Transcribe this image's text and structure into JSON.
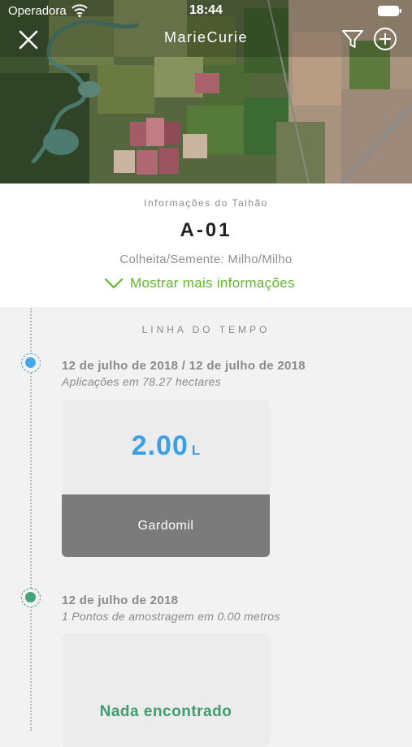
{
  "status_bar": {
    "carrier": "Operadora",
    "time": "18:44"
  },
  "nav": {
    "title": "MarieCurie"
  },
  "icons": {
    "close": "close-icon",
    "filter": "filter-icon",
    "add": "add-circle-icon",
    "wifi": "wifi-icon",
    "battery": "battery-icon",
    "more": "chevron-down-icon"
  },
  "colors": {
    "accent_green": "#5fb82f",
    "application_blue": "#3a9fe6",
    "sample_green": "#3f9e70"
  },
  "plot": {
    "section_label": "Informações do Talhão",
    "name": "A-01",
    "harvest": "Colheita/Semente: Milho/Milho",
    "more_info": "Mostrar mais informações"
  },
  "timeline": {
    "title": "LINHA DO TEMPO",
    "events": [
      {
        "date": "12 de julho de 2018 / 12 de julho de 2018",
        "subtitle": "Aplicações em 78.27 hectares",
        "amount": "2.00",
        "unit": "L",
        "product": "Gardomil"
      },
      {
        "date": "12 de julho de 2018",
        "subtitle": "1 Pontos de amostragem em 0.00 metros",
        "empty_text": "Nada encontrado"
      }
    ]
  }
}
